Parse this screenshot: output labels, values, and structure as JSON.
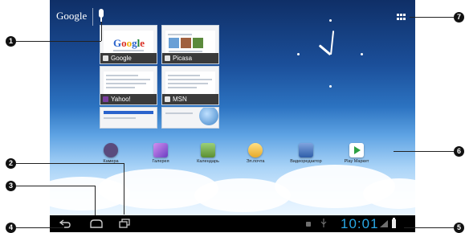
{
  "top": {
    "google_label": "Google"
  },
  "cards": [
    {
      "title": "Google",
      "logo": "Google"
    },
    {
      "title": "Picasa"
    },
    {
      "title": "Yahoo!"
    },
    {
      "title": "MSN"
    }
  ],
  "dock": [
    {
      "label": "Камера",
      "color": "#5a4b7d"
    },
    {
      "label": "Галерея",
      "color": "#9a6fd1"
    },
    {
      "label": "Календарь",
      "color": "#6ea43a"
    },
    {
      "label": "Эл.почта",
      "color": "#f0c33b"
    },
    {
      "label": "Видеоредактор",
      "color": "#4a71b9"
    },
    {
      "label": "Play Маркет",
      "color": "#ffffff"
    }
  ],
  "status": {
    "time": "10:01"
  },
  "callouts": [
    "1",
    "2",
    "3",
    "4",
    "5",
    "6",
    "7"
  ]
}
